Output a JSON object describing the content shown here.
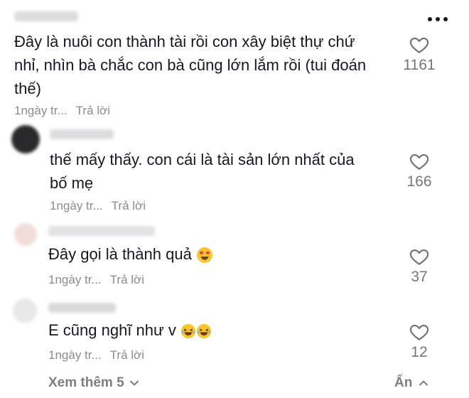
{
  "comments": [
    {
      "text_lines": [
        "Đây là nuôi con thành tài rồi con xây biệt thự chứ",
        "nhỉ, nhìn bà chắc con bà cũng lớn lắm rồi (tui đoán",
        "thế)"
      ],
      "time": "1ngày tr...",
      "reply": "Trả lời",
      "likes": "1161"
    },
    {
      "text_lines": [
        "thế mấy thấy. con cái là tài sản lớn nhất của",
        "bố mẹ"
      ],
      "time": "1ngày tr...",
      "reply": "Trả lời",
      "likes": "166"
    },
    {
      "text": "Đây gọi là thành quả",
      "time": "1ngày tr...",
      "reply": "Trả lời",
      "likes": "37"
    },
    {
      "text": "E cũng nghĩ như v",
      "time": "1ngày tr...",
      "reply": "Trả lời",
      "likes": "12"
    }
  ],
  "footer": {
    "see_more": "Xem thêm 5",
    "hide": "Ẩn"
  },
  "colors": {
    "text": "#161823",
    "meta": "#8a8b91",
    "heart_stroke": "#75767c"
  }
}
